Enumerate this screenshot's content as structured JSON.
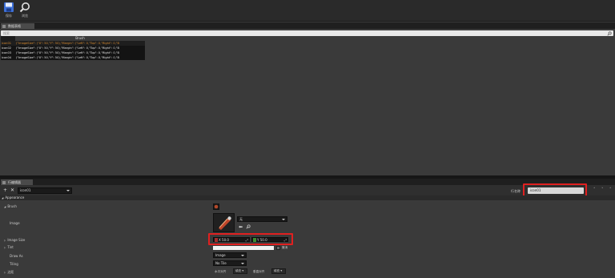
{
  "toolbar": {
    "buttons": [
      {
        "label": "保存",
        "icon": "save-icon"
      },
      {
        "label": "浏览",
        "icon": "browse-icon"
      }
    ]
  },
  "data_table": {
    "tab_label": "数据表格",
    "search_placeholder": "搜索",
    "column_header": "Brush",
    "rows": [
      {
        "name": "icon01",
        "value": "(\"ImageSize\": (\"X\": 50,\"Y\": 50),\"Margin\": (\"Left\": 0,\"Top\": 0,\"Right\": 0,\"B",
        "selected": true
      },
      {
        "name": "icon02",
        "value": "(\"ImageSize\": (\"X\": 50,\"Y\": 50),\"Margin\": (\"Left\": 0,\"Top\": 0,\"Right\": 0,\"B",
        "selected": false
      },
      {
        "name": "icon03",
        "value": "(\"ImageSize\": (\"X\": 50,\"Y\": 50),\"Margin\": (\"Left\": 0,\"Top\": 0,\"Right\": 0,\"B",
        "selected": false
      },
      {
        "name": "icon04",
        "value": "(\"ImageSize\": (\"X\": 50,\"Y\": 50),\"Margin\": (\"Left\": 0,\"Top\": 0,\"Right\": 0,\"B",
        "selected": false
      }
    ]
  },
  "details": {
    "tab_label": "行编辑器",
    "row_select_value": "icon01",
    "row_name_label": "行名称",
    "row_name_value": "icon01",
    "category": "Appearance",
    "brush_label": "Brush",
    "image_label": "Image",
    "image_asset_value": "无",
    "image_size_label": "Image Size",
    "image_size_x_axis": "X",
    "image_size_x": "50.0",
    "image_size_y_axis": "Y",
    "image_size_y": "50.0",
    "tint_label": "Tint",
    "tint_checkbox_label": "撤消",
    "draw_as_label": "Draw As",
    "draw_as_value": "Image",
    "tiling_label": "Tiling",
    "tiling_value": "No Tile",
    "margin_label": "边距",
    "h_align_label": "水平对齐",
    "h_align_value": "填充",
    "v_align_label": "垂直对齐",
    "v_align_value": "填充"
  },
  "colors": {
    "highlight_red": "#e02020",
    "selected_row_text": "#d88a2e"
  }
}
